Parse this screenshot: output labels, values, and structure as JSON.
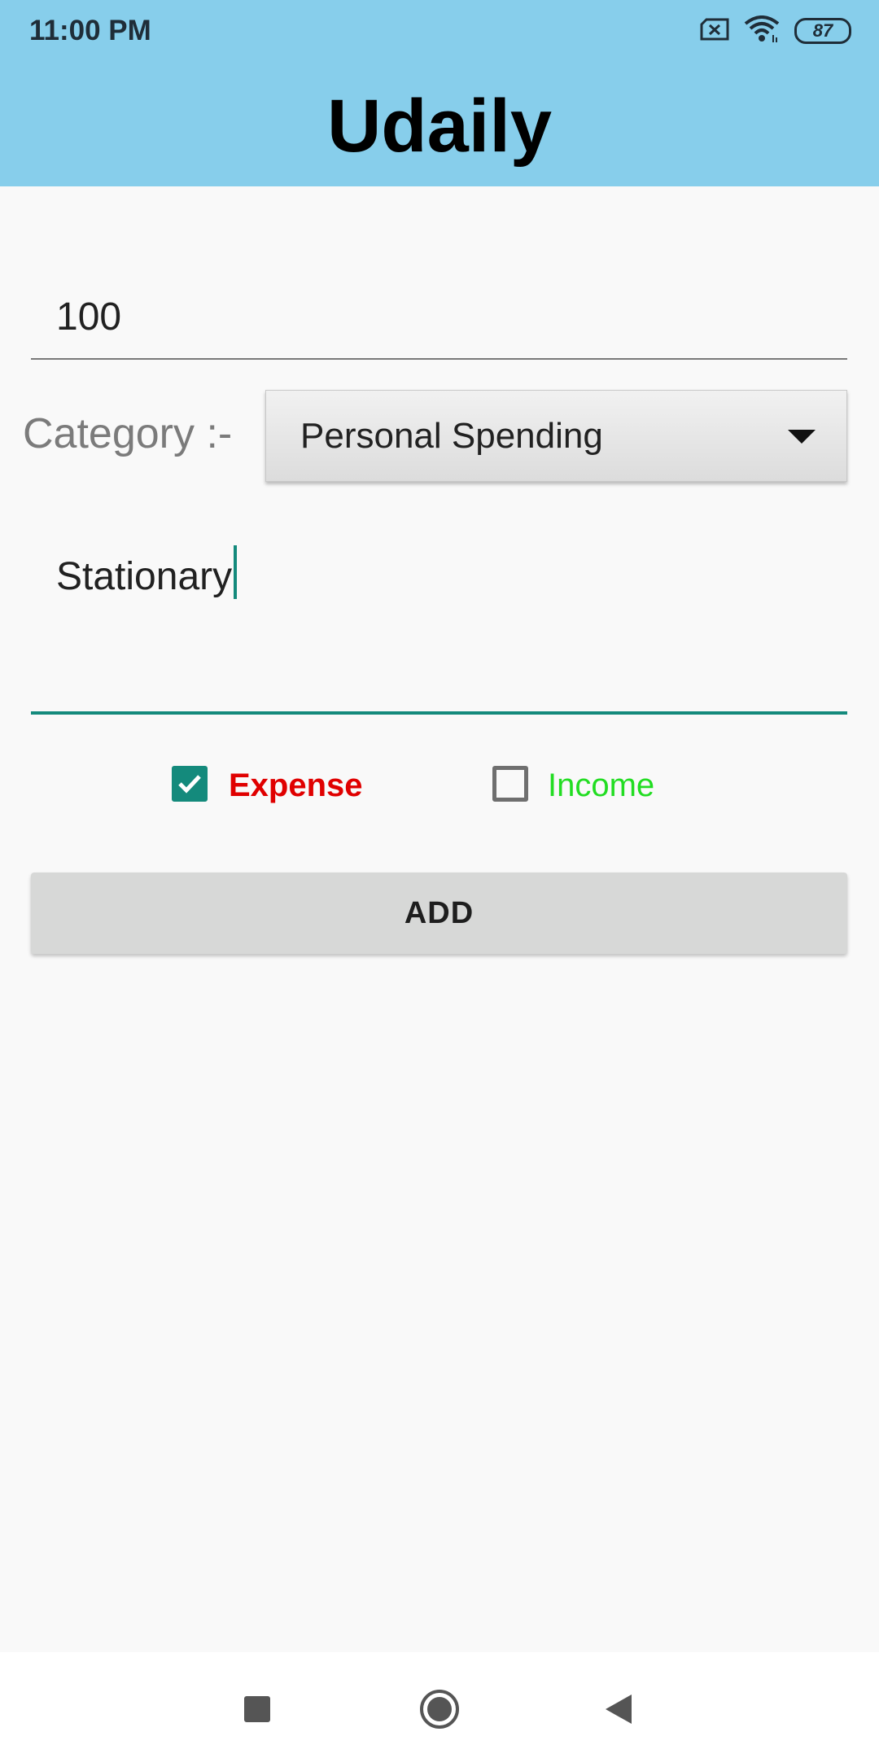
{
  "status_bar": {
    "time": "11:00 PM",
    "battery_level": "87",
    "icons": [
      "sim-error-icon",
      "wifi-icon",
      "battery-icon"
    ]
  },
  "header": {
    "title": "Udaily",
    "background_color": "#87ceeb"
  },
  "form": {
    "amount_value": "100",
    "category_label": "Category :-",
    "category_selected": "Personal Spending",
    "note_value": "Stationary",
    "expense_label": "Expense",
    "expense_checked": true,
    "expense_color": "#e00000",
    "income_label": "Income",
    "income_checked": false,
    "income_color": "#22dd22",
    "accent_color": "#148a7c",
    "add_button_label": "ADD"
  },
  "nav_bar": {
    "icons": [
      "recents-icon",
      "home-icon",
      "back-icon"
    ]
  }
}
